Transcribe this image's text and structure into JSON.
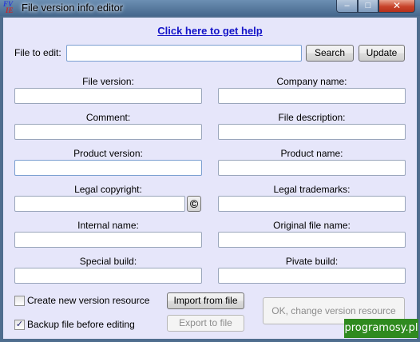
{
  "window": {
    "title": "File version info editor",
    "icon": "fv-app-icon",
    "controls": {
      "minimize": "–",
      "maximize": "□",
      "close": "✕"
    }
  },
  "help_link": "Click here to get help",
  "file": {
    "label": "File to edit:",
    "value": "",
    "search_label": "Search",
    "update_label": "Update"
  },
  "fields": {
    "file_version": {
      "label": "File version:",
      "value": ""
    },
    "company_name": {
      "label": "Company name:",
      "value": ""
    },
    "comment": {
      "label": "Comment:",
      "value": ""
    },
    "file_description": {
      "label": "File description:",
      "value": ""
    },
    "product_version": {
      "label": "Product version:",
      "value": ""
    },
    "product_name": {
      "label": "Product name:",
      "value": ""
    },
    "legal_copyright": {
      "label": "Legal copyright:",
      "value": "",
      "button_glyph": "©"
    },
    "legal_trademarks": {
      "label": "Legal trademarks:",
      "value": ""
    },
    "internal_name": {
      "label": "Internal name:",
      "value": ""
    },
    "original_file_name": {
      "label": "Original file name:",
      "value": ""
    },
    "special_build": {
      "label": "Special build:",
      "value": ""
    },
    "private_build": {
      "label": "Pivate build:",
      "value": ""
    }
  },
  "options": {
    "create_new": {
      "label": "Create new version resource",
      "checked": false
    },
    "backup": {
      "label": "Backup file before editing",
      "checked": true,
      "mark": "✓"
    }
  },
  "buttons": {
    "import": "Import from file",
    "export": "Export to file",
    "ok": "OK, change version resource"
  },
  "watermark": "programosy.pl"
}
